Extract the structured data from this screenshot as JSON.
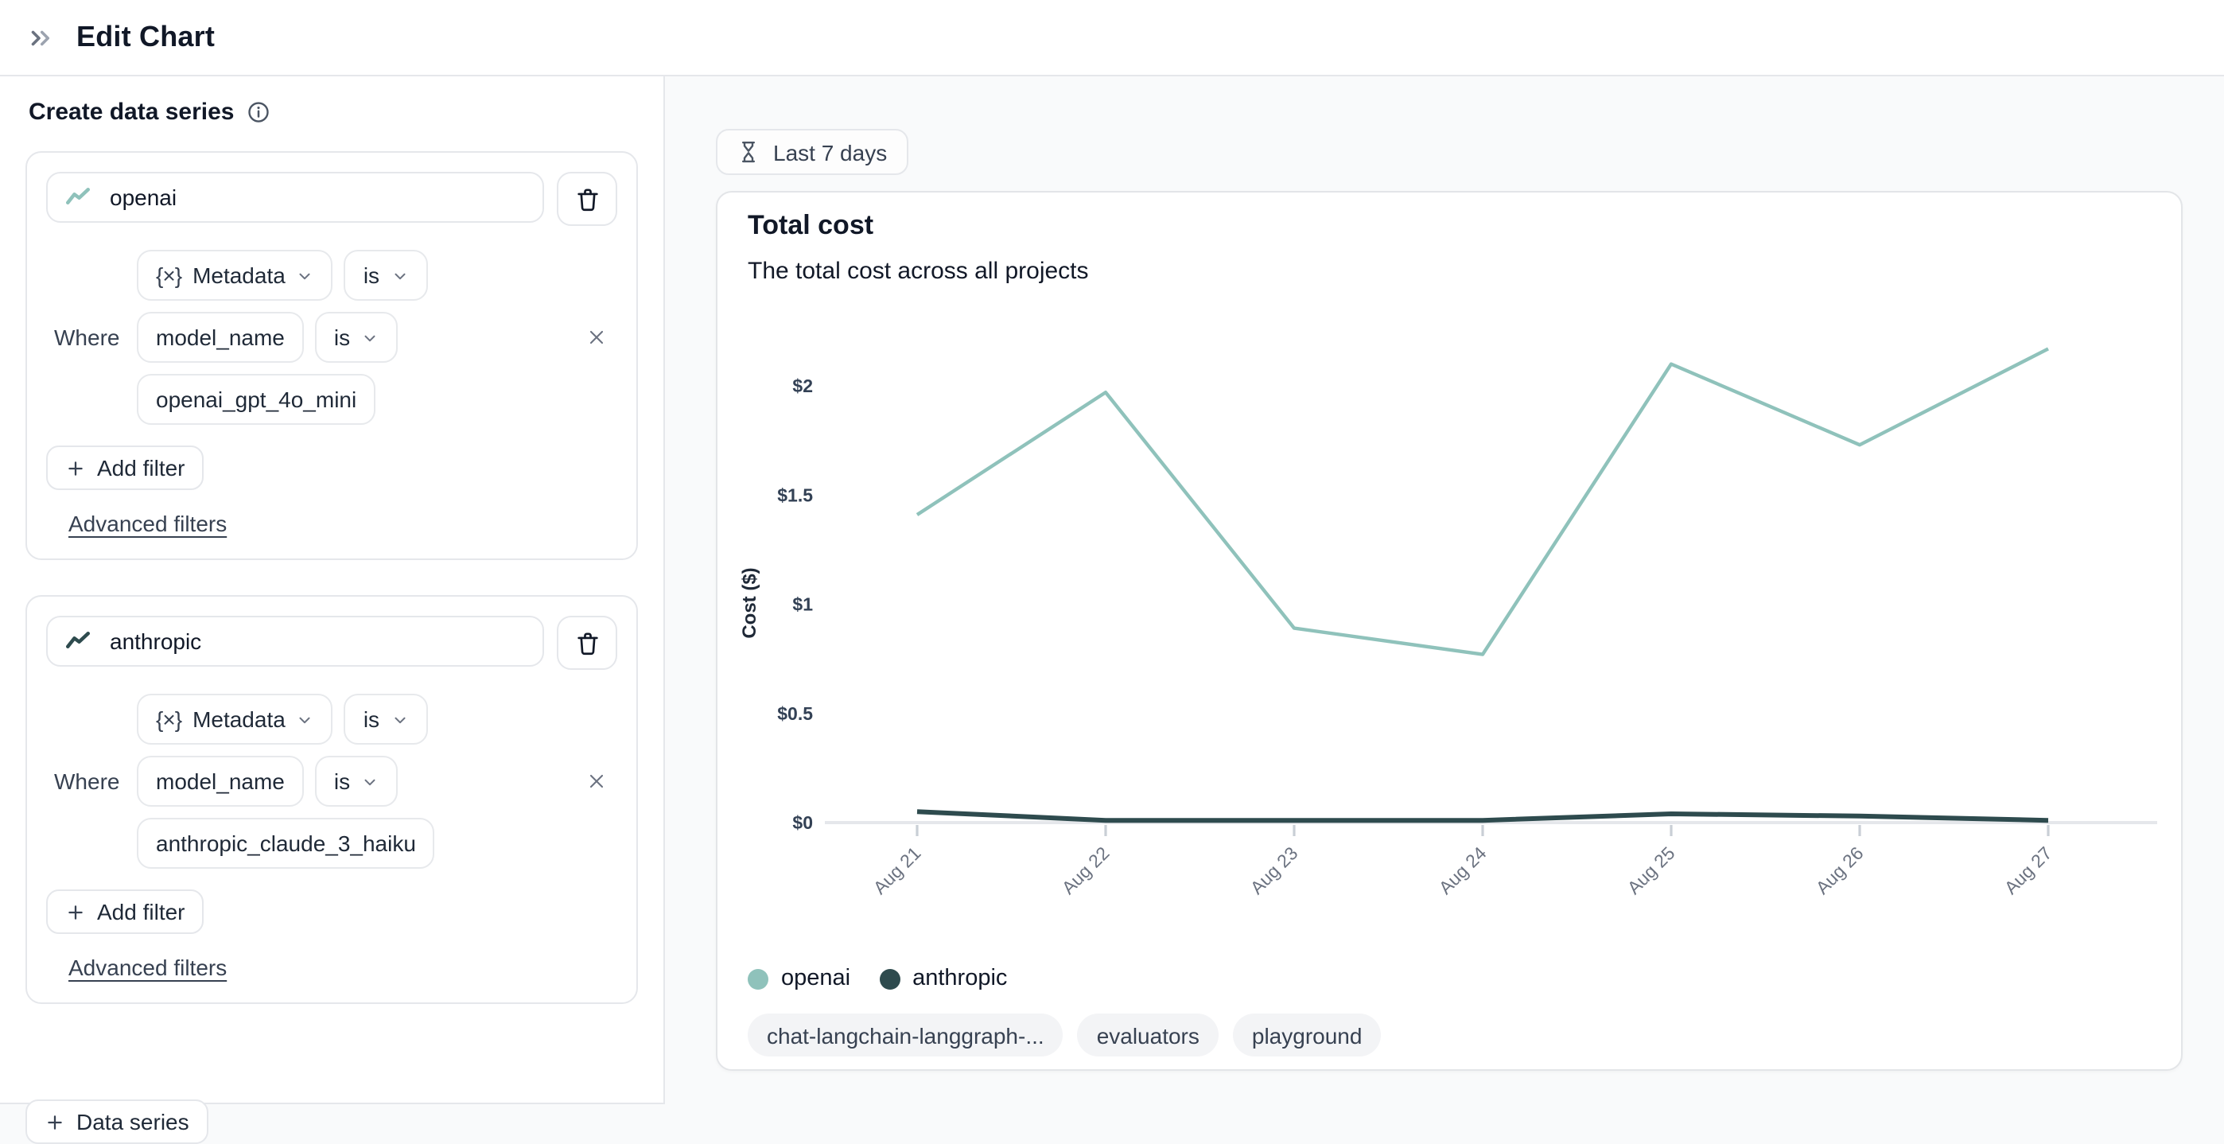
{
  "header": {
    "title": "Edit Chart",
    "collapse_icon": "double-chevron-right-icon"
  },
  "sidebar": {
    "heading": "Create data series",
    "info_icon": "info-icon",
    "labels": {
      "where": "Where",
      "metadata_prefix": "{×}",
      "metadata": "Metadata",
      "is": "is",
      "add_filter": "Add filter",
      "advanced_filters": "Advanced filters",
      "add_series": "Data series"
    },
    "series": [
      {
        "name": "openai",
        "color": "#8fc2bb",
        "icon": "trend-line-icon",
        "filter": {
          "key": "model_name",
          "op": "is",
          "value": "openai_gpt_4o_mini"
        }
      },
      {
        "name": "anthropic",
        "color": "#2e4b4e",
        "icon": "trend-line-icon",
        "filter": {
          "key": "model_name",
          "op": "is",
          "value": "anthropic_claude_3_haiku"
        }
      }
    ]
  },
  "toolbar": {
    "time_range": "Last 7 days",
    "time_icon": "hourglass-icon"
  },
  "chart_card": {
    "title": "Total cost",
    "subtitle": "The total cost across all projects"
  },
  "chart_data": {
    "type": "line",
    "title": "Total cost",
    "x": [
      "Aug 21",
      "Aug 22",
      "Aug 23",
      "Aug 24",
      "Aug 25",
      "Aug 26",
      "Aug 27"
    ],
    "series": [
      {
        "name": "openai",
        "color": "#8fc2bb",
        "values": [
          1.41,
          1.97,
          0.89,
          0.77,
          2.1,
          1.73,
          2.17
        ]
      },
      {
        "name": "anthropic",
        "color": "#2e4b4e",
        "values": [
          0.05,
          0.01,
          0.01,
          0.01,
          0.04,
          0.03,
          0.01
        ]
      }
    ],
    "ylabel": "Cost ($)",
    "yticks": [
      {
        "label": "$0",
        "value": 0
      },
      {
        "label": "$0.5",
        "value": 0.5
      },
      {
        "label": "$1",
        "value": 1
      },
      {
        "label": "$1.5",
        "value": 1.5
      },
      {
        "label": "$2",
        "value": 2
      }
    ],
    "ylim": [
      0,
      2.25
    ],
    "grid": false,
    "legend_position": "bottom"
  },
  "tags": [
    "chat-langchain-langgraph-...",
    "evaluators",
    "playground"
  ],
  "colors": {
    "axis_line": "#e5e7eb",
    "axis_tick": "#c9cfd6",
    "x_label": "#6b7280",
    "y_label": "#334155"
  }
}
